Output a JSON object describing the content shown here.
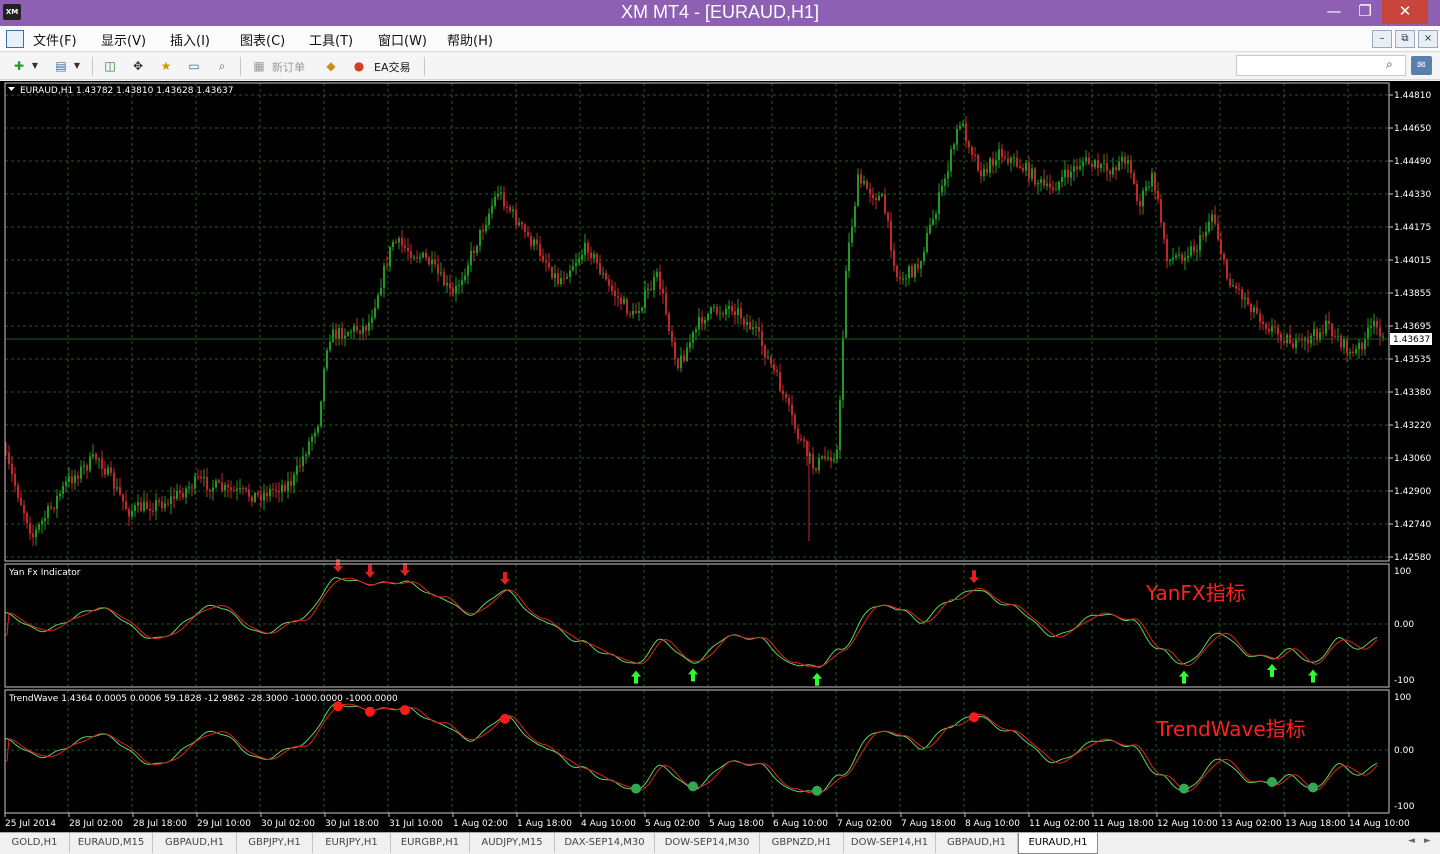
{
  "window": {
    "title": "XM MT4 - [EURAUD,H1]",
    "app_logo": "XM",
    "minimize": "—",
    "maximize": "❐",
    "close": "✕"
  },
  "menu": {
    "items": [
      "文件(F)",
      "显示(V)",
      "插入(I)",
      "图表(C)",
      "工具(T)",
      "窗口(W)",
      "帮助(H)"
    ],
    "mdi_min": "–",
    "mdi_restore": "⧉",
    "mdi_close": "×"
  },
  "toolbar": {
    "new_order": "新订单",
    "ea_trading": "EA交易",
    "search_icon": "⌕",
    "chat_icon": "✉"
  },
  "chart": {
    "header": "EURAUD,H1  1.43782 1.43810 1.43628 1.43637",
    "price_axis": [
      "1.44810",
      "1.44650",
      "1.44490",
      "1.44330",
      "1.44175",
      "1.44015",
      "1.43855",
      "1.43695",
      "1.43535",
      "1.43380",
      "1.43220",
      "1.43060",
      "1.42900",
      "1.42740",
      "1.42580"
    ],
    "current_price": "1.43637",
    "time_axis": [
      "25 Jul 2014",
      "28 Jul 02:00",
      "28 Jul 18:00",
      "29 Jul 10:00",
      "30 Jul 02:00",
      "30 Jul 18:00",
      "31 Jul 10:00",
      "1 Aug 02:00",
      "1 Aug 18:00",
      "4 Aug 10:00",
      "5 Aug 02:00",
      "5 Aug 18:00",
      "6 Aug 10:00",
      "7 Aug 02:00",
      "7 Aug 18:00",
      "8 Aug 10:00",
      "11 Aug 02:00",
      "11 Aug 18:00",
      "12 Aug 10:00",
      "13 Aug 02:00",
      "13 Aug 18:00",
      "14 Aug 10:00"
    ],
    "colors": {
      "background": "#000000",
      "grid": "#1e5a1e",
      "bull": "#1f9a1f",
      "bear": "#c0282d",
      "signal_green": "#5cd65c",
      "signal_red": "#e02020",
      "annotation": "#ff2020"
    }
  },
  "indicators": [
    {
      "name": "Yan Fx Indicator",
      "axis": [
        "100",
        "0.00",
        "-100"
      ],
      "annotation": "YanFX指标"
    },
    {
      "name": "TrendWave 1.4364 0.0005 0.0006 59.1828 -12.9862 -28.3000 -1000.0000 -1000.0000",
      "axis": [
        "100",
        "0.00",
        "-100"
      ],
      "annotation": "TrendWave指标"
    }
  ],
  "tabs": [
    "GOLD,H1",
    "EURAUD,M15",
    "GBPAUD,H1",
    "GBPJPY,H1",
    "EURJPY,H1",
    "EURGBP,H1",
    "AUDJPY,M15",
    "DAX-SEP14,M30",
    "DOW-SEP14,M30",
    "GBPNZD,H1",
    "DOW-SEP14,H1",
    "GBPAUD,H1",
    "EURAUD,H1"
  ],
  "active_tab": "EURAUD,H1"
}
